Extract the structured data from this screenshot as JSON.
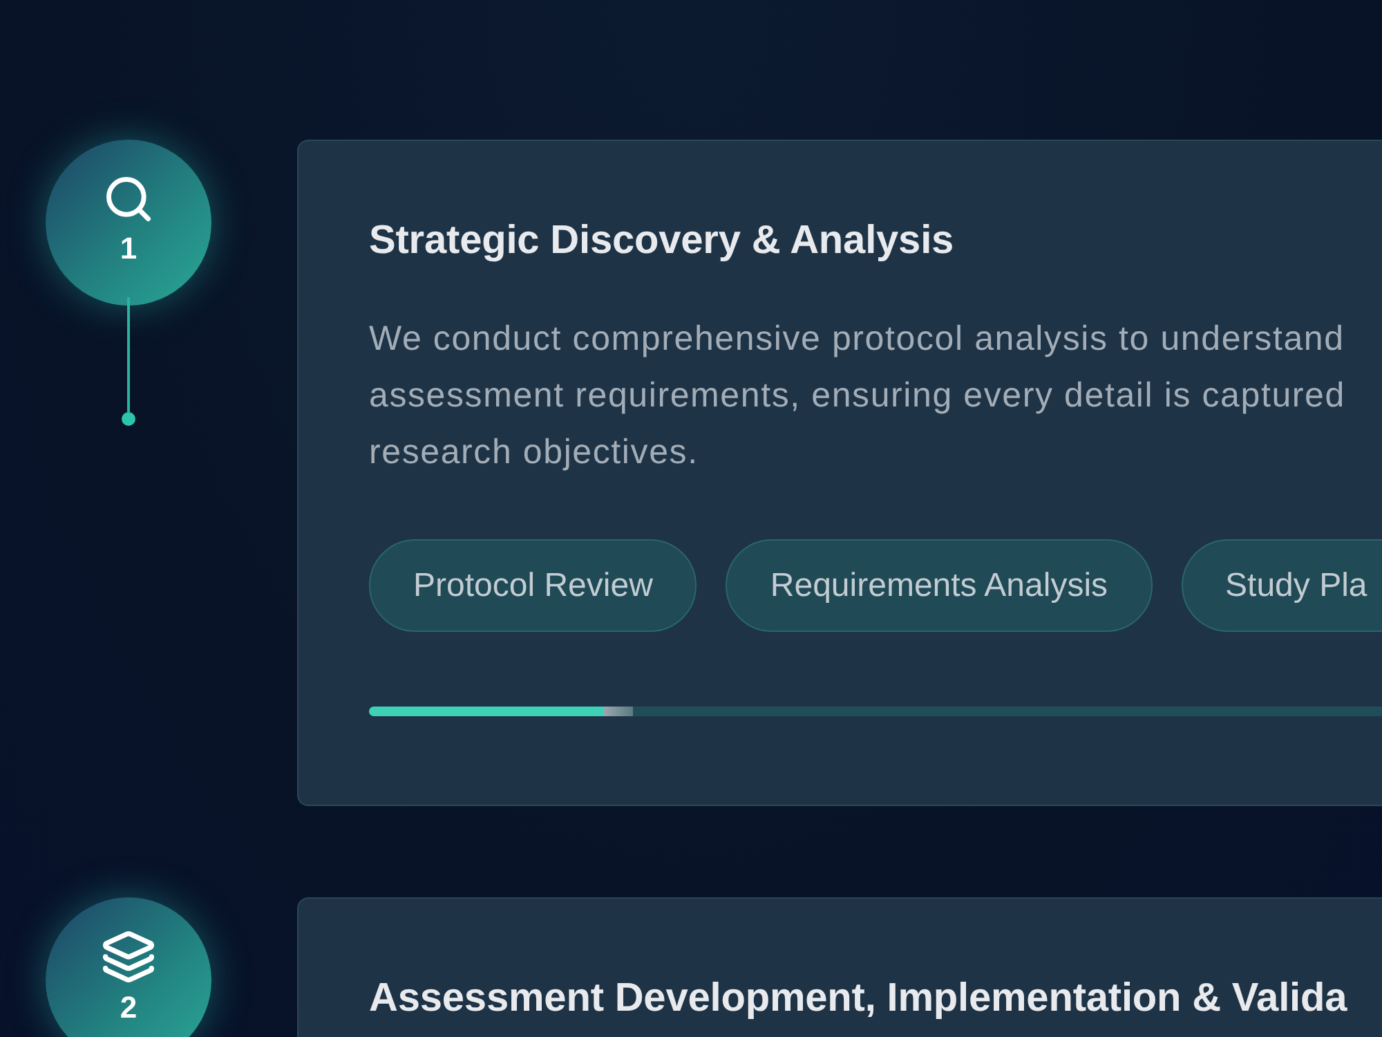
{
  "steps": [
    {
      "number": "1",
      "title": "Strategic Discovery & Analysis",
      "description_lines": [
        "We conduct comprehensive protocol analysis to understand",
        "assessment requirements, ensuring every detail is captured",
        "research objectives."
      ],
      "tags": [
        "Protocol Review",
        "Requirements Analysis",
        "Study Pla"
      ],
      "progress": {
        "level": 0.26
      }
    },
    {
      "number": "2",
      "title": "Assessment Development, Implementation & Valida"
    }
  ]
}
